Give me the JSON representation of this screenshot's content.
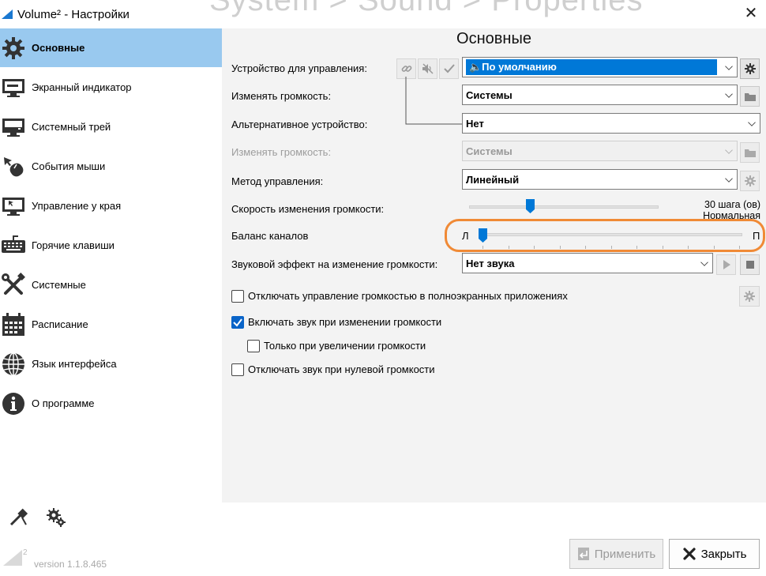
{
  "window": {
    "title": "Volume² - Настройки",
    "bg_ghost": "System > Sound > Properties"
  },
  "sidebar": {
    "items": [
      {
        "label": "Основные",
        "icon": "gear-icon"
      },
      {
        "label": "Экранный индикатор",
        "icon": "monitor-icon"
      },
      {
        "label": "Системный трей",
        "icon": "tray-icon"
      },
      {
        "label": "События мыши",
        "icon": "mouse-icon"
      },
      {
        "label": "Управление у края",
        "icon": "screen-edge-icon"
      },
      {
        "label": "Горячие клавиши",
        "icon": "keyboard-icon"
      },
      {
        "label": "Системные",
        "icon": "tools-icon"
      },
      {
        "label": "Расписание",
        "icon": "calendar-icon"
      },
      {
        "label": "Язык интерфейса",
        "icon": "globe-icon"
      },
      {
        "label": "О программе",
        "icon": "info-icon"
      }
    ],
    "version": "version 1.1.8.465",
    "logo_sup": "2"
  },
  "main": {
    "heading": "Основные",
    "rows": {
      "device_label": "Устройство для управления:",
      "device_value": "🔈По умолчанию",
      "volume1_label": "Изменять громкость:",
      "volume1_value": "Системы",
      "alt_label": "Альтернативное устройство:",
      "alt_value": "Нет",
      "volume2_label": "Изменять громкость:",
      "volume2_value": "Системы",
      "method_label": "Метод управления:",
      "method_value": "Линейный",
      "speed_label": "Скорость изменения громкости:",
      "speed_value": "30 шага (ов)",
      "speed_sub": "Нормальная",
      "speed_fraction": 0.3,
      "balance_label": "Баланс каналов",
      "balance_left": "Л",
      "balance_right": "П",
      "balance_fraction": 0.0,
      "effect_label": "Звуковой эффект на изменение громкости:",
      "effect_value": "Нет звука"
    },
    "checks": {
      "fullscreen": {
        "label": "Отключать управление громкостью в полноэкранных приложениях",
        "checked": false
      },
      "unmute": {
        "label": "Включать звук при изменении громкости",
        "checked": true
      },
      "only_increase": {
        "label": "Только при увеличении громкости",
        "checked": false
      },
      "mute_zero": {
        "label": "Отключать звук при нулевой громкости",
        "checked": false
      }
    }
  },
  "footer": {
    "apply": "Применить",
    "close": "Закрыть"
  },
  "colors": {
    "accent": "#0078d7",
    "sidebar_active": "#99c9ef",
    "highlight": "#f08a36"
  }
}
